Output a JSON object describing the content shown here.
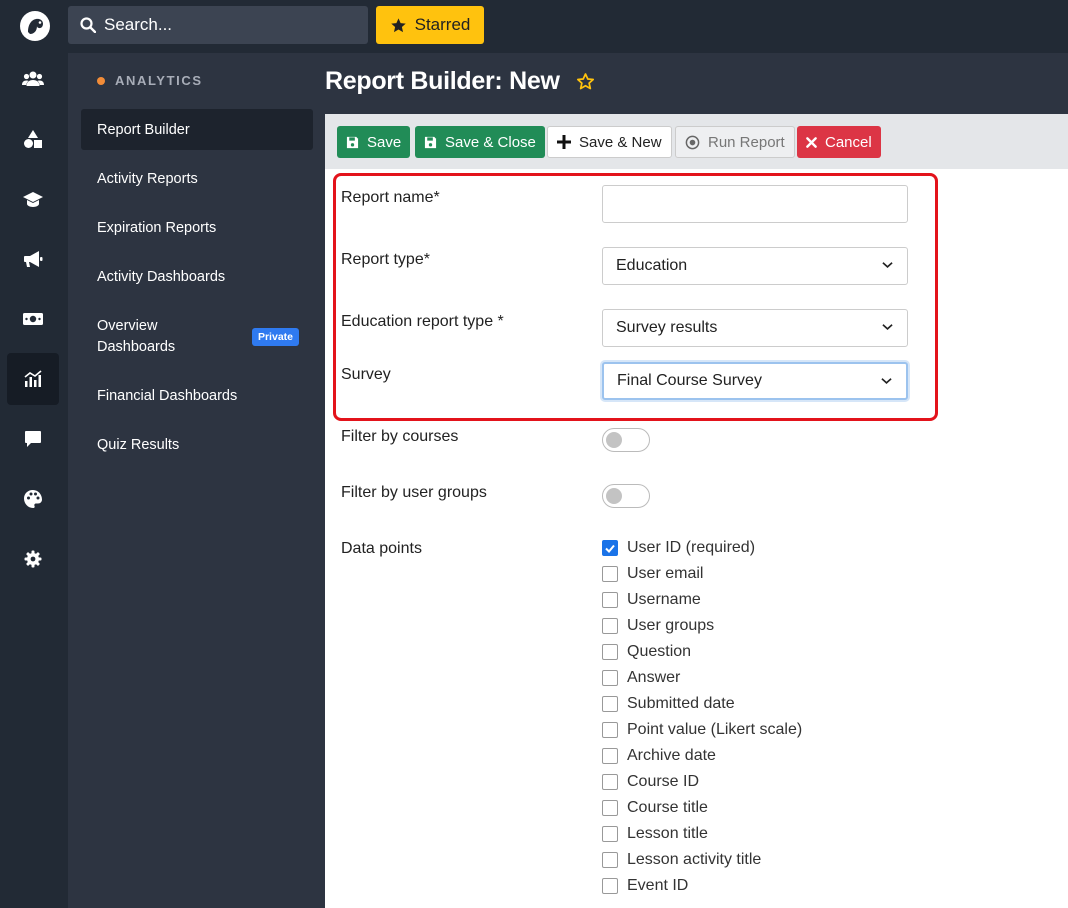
{
  "search": {
    "placeholder": "Search..."
  },
  "starred": {
    "label": "Starred"
  },
  "sidebar": {
    "section": "ANALYTICS",
    "items": [
      {
        "label": "Report Builder"
      },
      {
        "label": "Activity Reports"
      },
      {
        "label": "Expiration Reports"
      },
      {
        "label": "Activity Dashboards"
      },
      {
        "label": "Overview Dashboards",
        "badge": "Private"
      },
      {
        "label": "Financial Dashboards"
      },
      {
        "label": "Quiz Results"
      }
    ]
  },
  "page": {
    "title": "Report Builder: New"
  },
  "toolbar": {
    "save": "Save",
    "save_close": "Save & Close",
    "save_new": "Save & New",
    "run_report": "Run Report",
    "cancel": "Cancel"
  },
  "form": {
    "report_name": {
      "label": "Report name*",
      "value": ""
    },
    "report_type": {
      "label": "Report type*",
      "value": "Education"
    },
    "education_report_type": {
      "label": "Education report type *",
      "value": "Survey results"
    },
    "survey": {
      "label": "Survey",
      "value": "Final Course Survey"
    },
    "filter_courses": {
      "label": "Filter by courses",
      "on": false
    },
    "filter_groups": {
      "label": "Filter by user groups",
      "on": false
    },
    "data_points": {
      "label": "Data points",
      "items": [
        {
          "label": "User ID (required)",
          "checked": true
        },
        {
          "label": "User email",
          "checked": false
        },
        {
          "label": "Username",
          "checked": false
        },
        {
          "label": "User groups",
          "checked": false
        },
        {
          "label": "Question",
          "checked": false
        },
        {
          "label": "Answer",
          "checked": false
        },
        {
          "label": "Submitted date",
          "checked": false
        },
        {
          "label": "Point value (Likert scale)",
          "checked": false
        },
        {
          "label": "Archive date",
          "checked": false
        },
        {
          "label": "Course ID",
          "checked": false
        },
        {
          "label": "Course title",
          "checked": false
        },
        {
          "label": "Lesson title",
          "checked": false
        },
        {
          "label": "Lesson activity title",
          "checked": false
        },
        {
          "label": "Event ID",
          "checked": false
        }
      ]
    }
  },
  "colors": {
    "accent_green": "#218c57",
    "accent_red": "#dc3545",
    "starred_yellow": "#ffc20e",
    "highlight_red": "#e3131b"
  }
}
